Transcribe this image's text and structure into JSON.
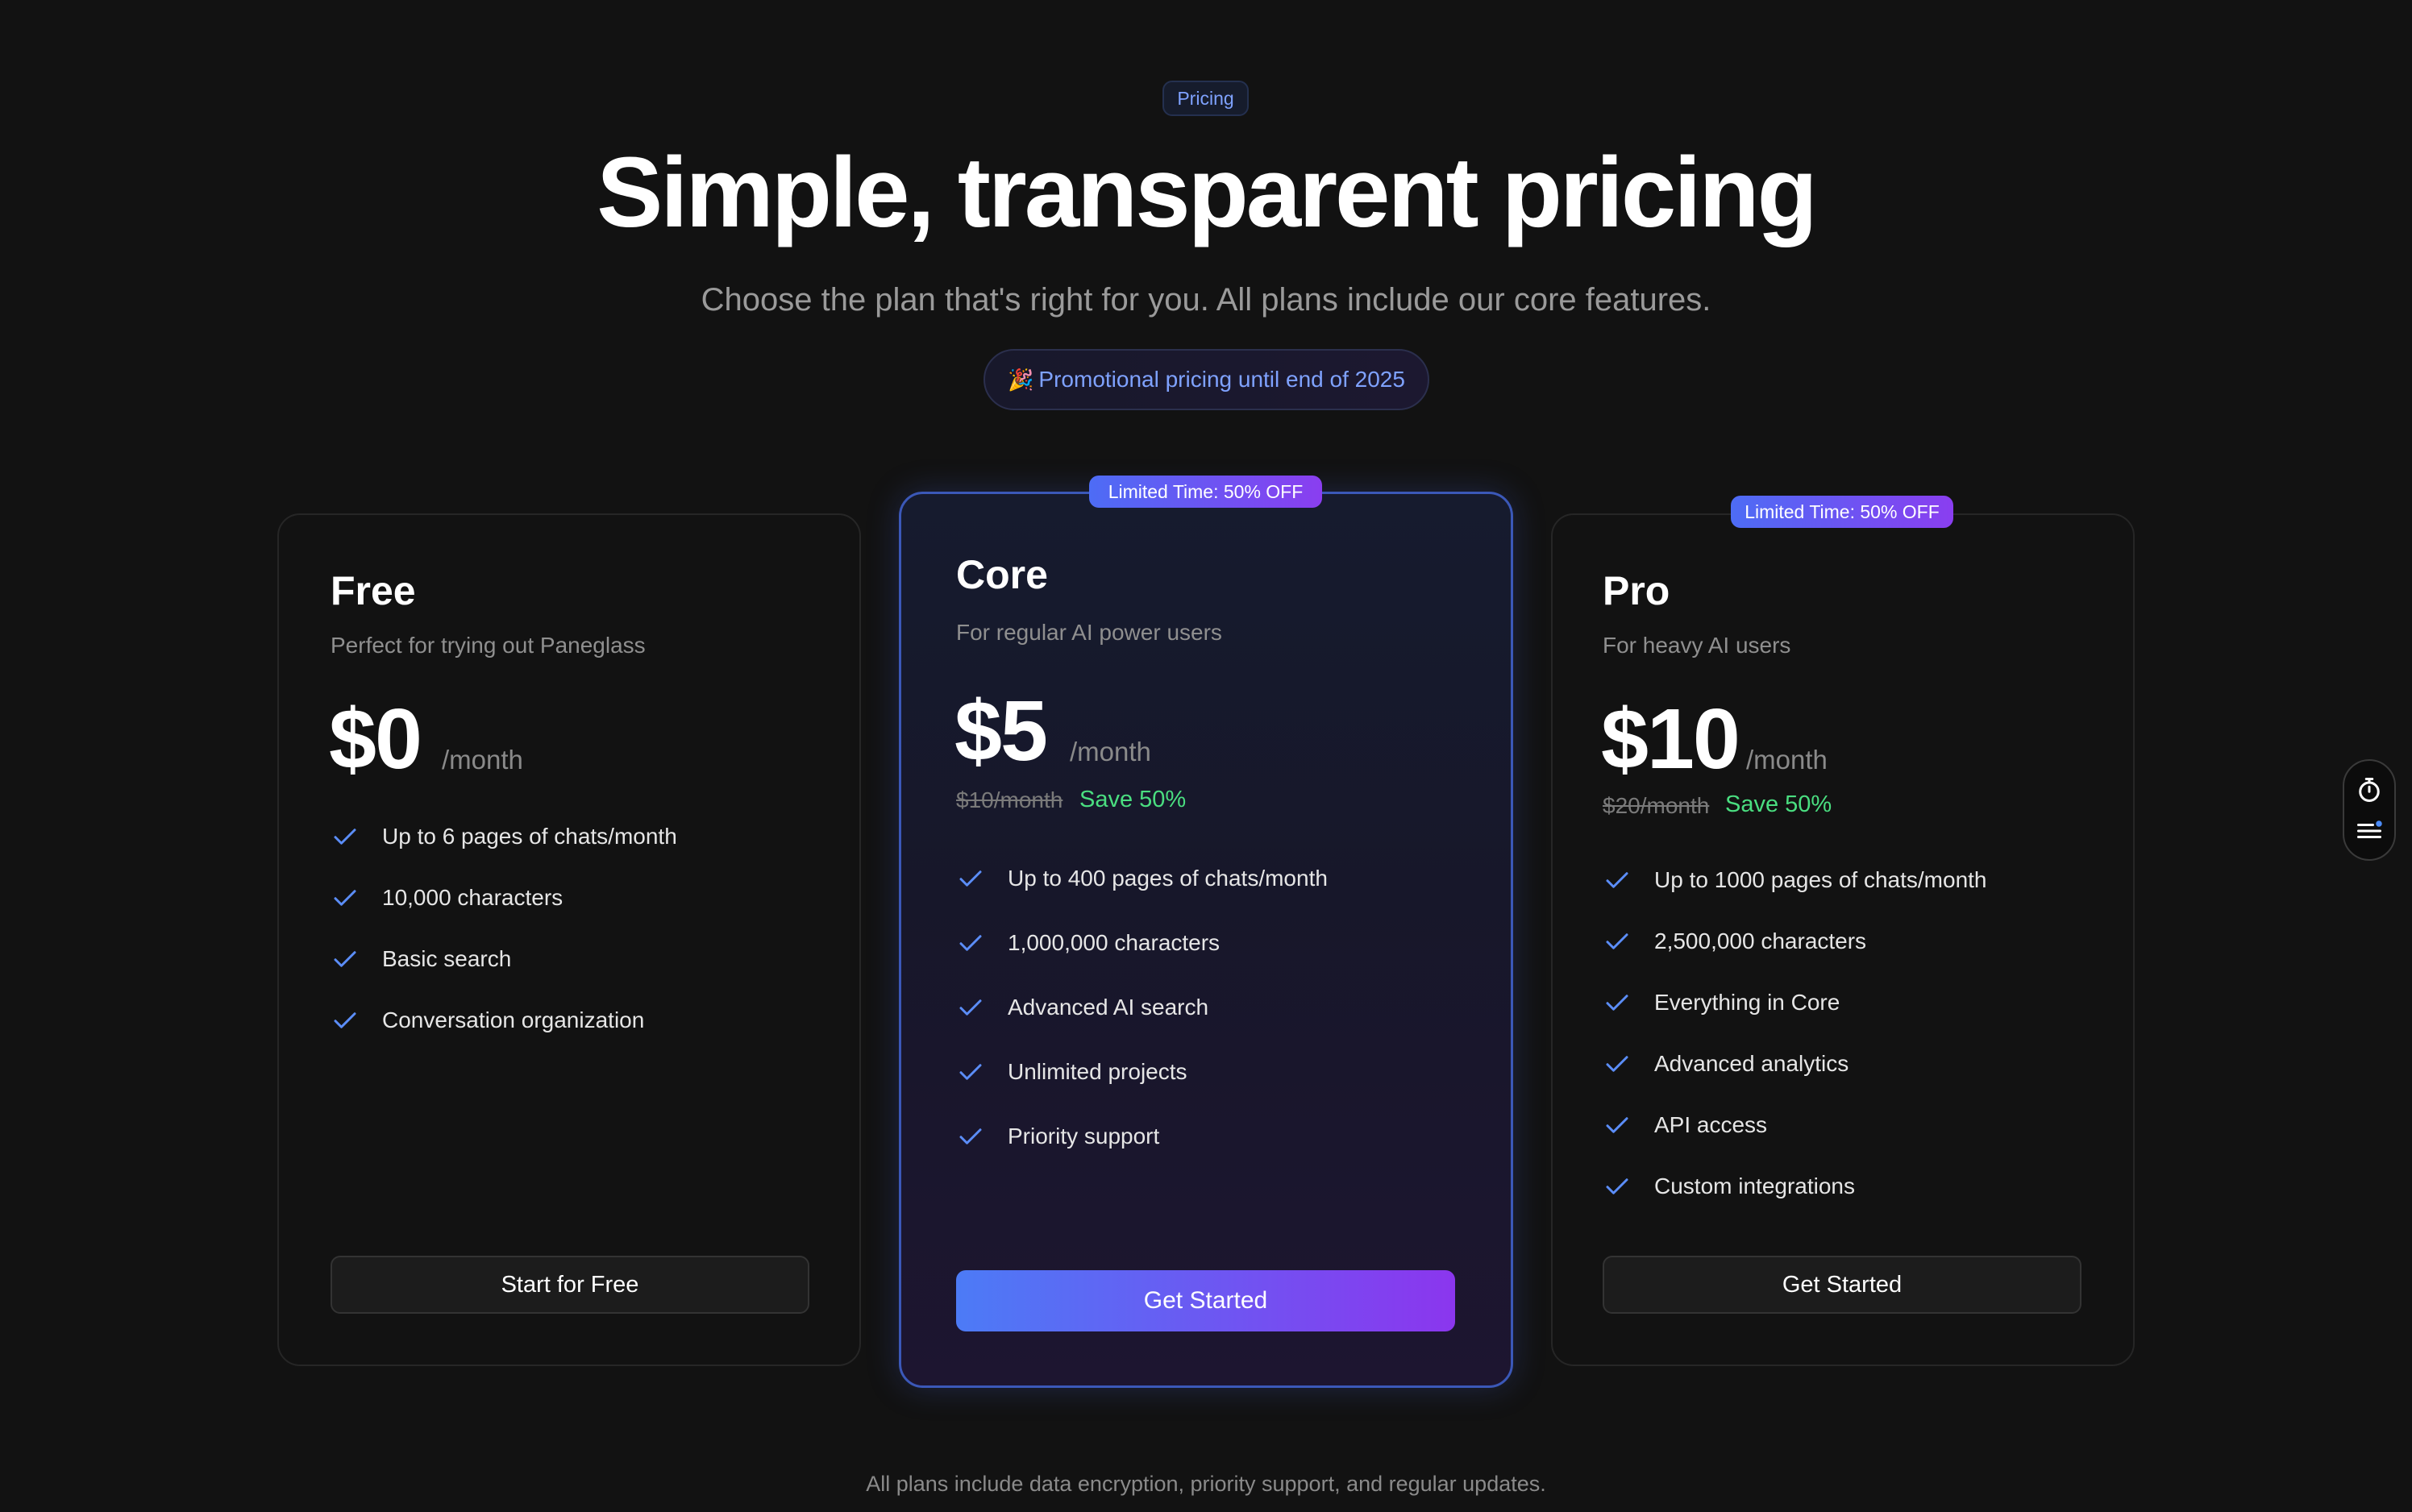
{
  "header": {
    "tag": "Pricing",
    "title": "Simple, transparent pricing",
    "subtitle": "Choose the plan that's right for you. All plans include our core features.",
    "promo_icon": "party-popper-icon",
    "promo_emoji": "🎉",
    "promo_text": "Promotional pricing until end of 2025"
  },
  "plans": [
    {
      "name": "Free",
      "description": "Perfect for trying out Paneglass",
      "price": "$0",
      "period": "/month",
      "features": [
        "Up to 6 pages of chats/month",
        "10,000 characters",
        "Basic search",
        "Conversation organization"
      ],
      "cta": "Start for Free"
    },
    {
      "name": "Core",
      "badge": "Limited Time: 50% OFF",
      "description": "For regular AI power users",
      "price": "$5",
      "period": "/month",
      "original_price": "$10/month",
      "savings": "Save 50%",
      "features": [
        "Up to 400 pages of chats/month",
        "1,000,000 characters",
        "Advanced AI search",
        "Unlimited projects",
        "Priority support"
      ],
      "cta": "Get Started"
    },
    {
      "name": "Pro",
      "badge": "Limited Time: 50% OFF",
      "description": "For heavy AI users",
      "price": "$10",
      "period": "/month",
      "original_price": "$20/month",
      "savings": "Save 50%",
      "features": [
        "Up to 1000 pages of chats/month",
        "2,500,000 characters",
        "Everything in Core",
        "Advanced analytics",
        "API access",
        "Custom integrations"
      ],
      "cta": "Get Started"
    }
  ],
  "footer": {
    "note": "All plans include data encryption, priority support, and regular updates."
  },
  "widget": {
    "icons": [
      "stopwatch-icon",
      "menu-list-icon"
    ]
  },
  "colors": {
    "background": "#121212",
    "accent_blue": "#4c7bf6",
    "accent_purple": "#8b36ee",
    "save_green": "#4ade80",
    "check_blue": "#5b8df7"
  }
}
